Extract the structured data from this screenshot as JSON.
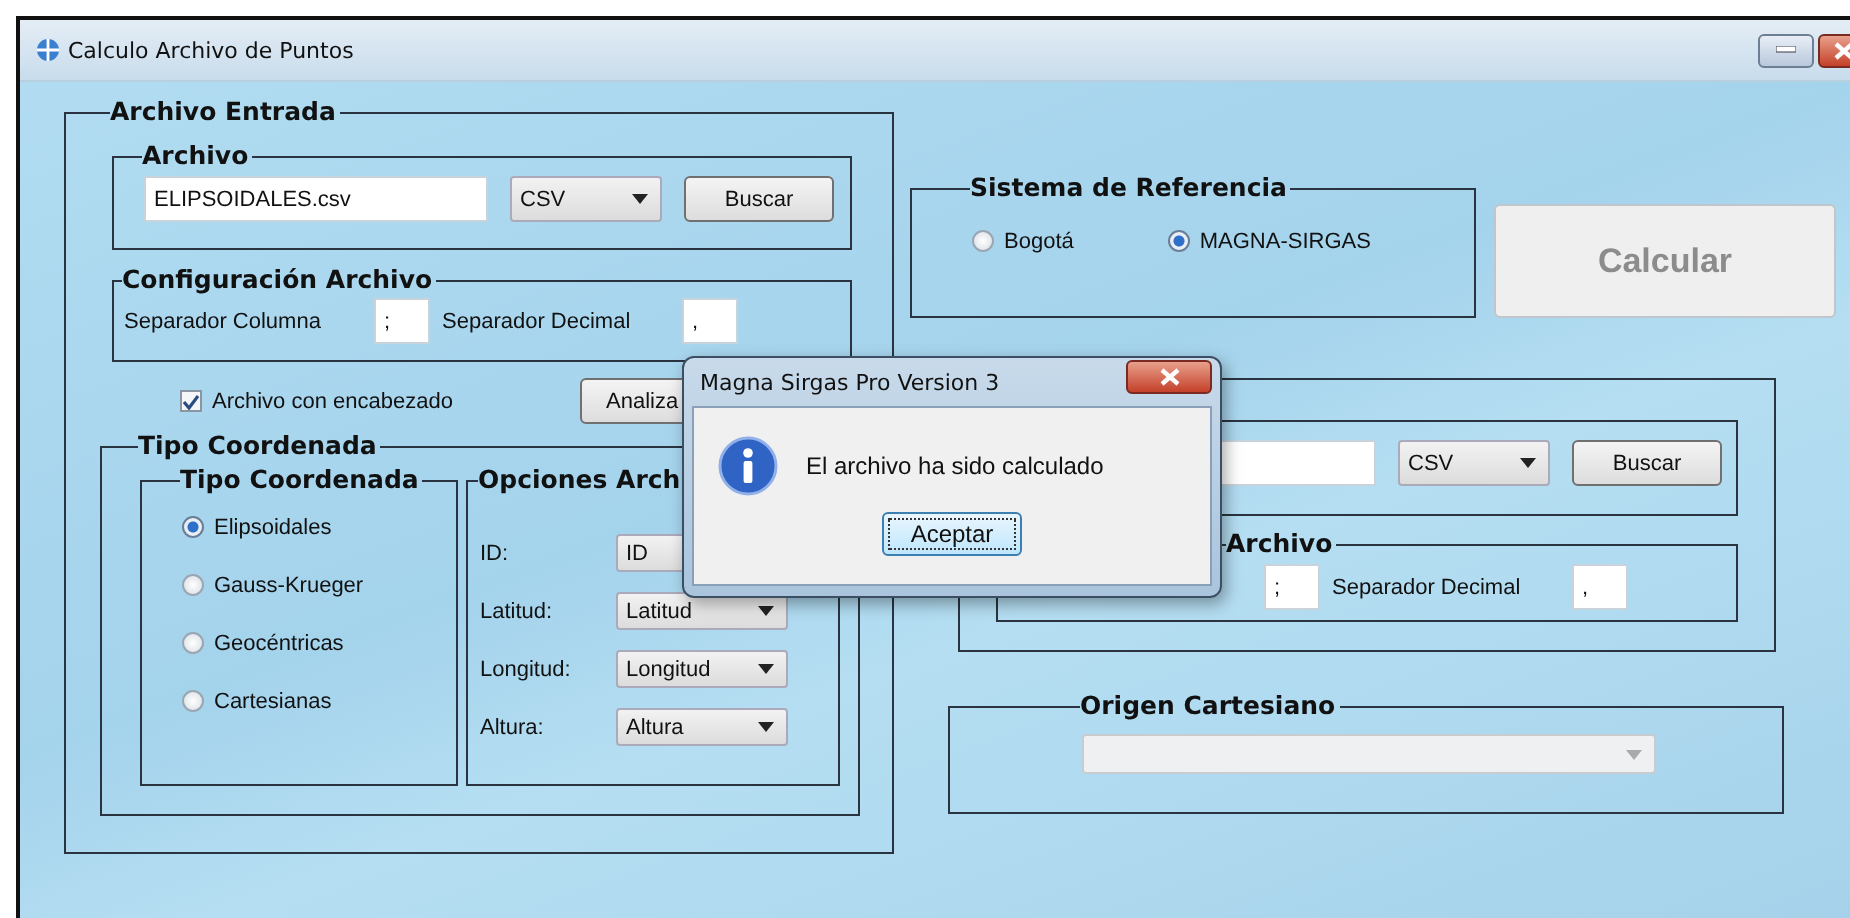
{
  "window": {
    "title": "Calculo Archivo de Puntos"
  },
  "archivo_entrada": {
    "title": "Archivo Entrada",
    "archivo": {
      "title": "Archivo",
      "file": "ELIPSOIDALES.csv",
      "format": "CSV",
      "browse": "Buscar"
    },
    "configuracion": {
      "title": "Configuración Archivo",
      "fields": [
        {
          "label": "Separador Columna",
          "value": ";"
        },
        {
          "label": "Separador Decimal",
          "value": ","
        }
      ]
    },
    "header_checkbox": {
      "label": "Archivo con encabezado",
      "checked": true
    },
    "analyze_button": "Analiza",
    "tipo_coordenada": {
      "title": "Tipo Coordenada",
      "tipos": {
        "title": "Tipo Coordenada",
        "options": [
          {
            "label": "Elipsoidales",
            "selected": true
          },
          {
            "label": "Gauss-Krueger",
            "selected": false
          },
          {
            "label": "Geocéntricas",
            "selected": false
          },
          {
            "label": "Cartesianas",
            "selected": false
          }
        ]
      },
      "opciones": {
        "title": "Opciones Arch",
        "rows": [
          {
            "label": "ID:",
            "value": "ID"
          },
          {
            "label": "Latitud:",
            "value": "Latitud"
          },
          {
            "label": "Longitud:",
            "value": "Longitud"
          },
          {
            "label": "Altura:",
            "value": "Altura"
          }
        ]
      }
    }
  },
  "sistema_referencia": {
    "title": "Sistema de Referencia",
    "options": [
      {
        "label": "Bogotá",
        "selected": false
      },
      {
        "label": "MAGNA-SIRGAS",
        "selected": true
      }
    ]
  },
  "calcular_button": {
    "label": "Calcular",
    "disabled": true
  },
  "archivo_salida": {
    "archivo": {
      "format": "CSV",
      "browse": "Buscar"
    },
    "configuracion": {
      "title": "Archivo",
      "fields": [
        {
          "value": ";"
        },
        {
          "label": "Separador Decimal",
          "value": ","
        }
      ]
    }
  },
  "origen_cartesiano": {
    "title": "Origen Cartesiano",
    "dropdown": {
      "disabled": true
    }
  },
  "dialog": {
    "title": "Magna Sirgas Pro Version 3",
    "message": "El archivo ha sido calculado",
    "button": "Aceptar"
  }
}
